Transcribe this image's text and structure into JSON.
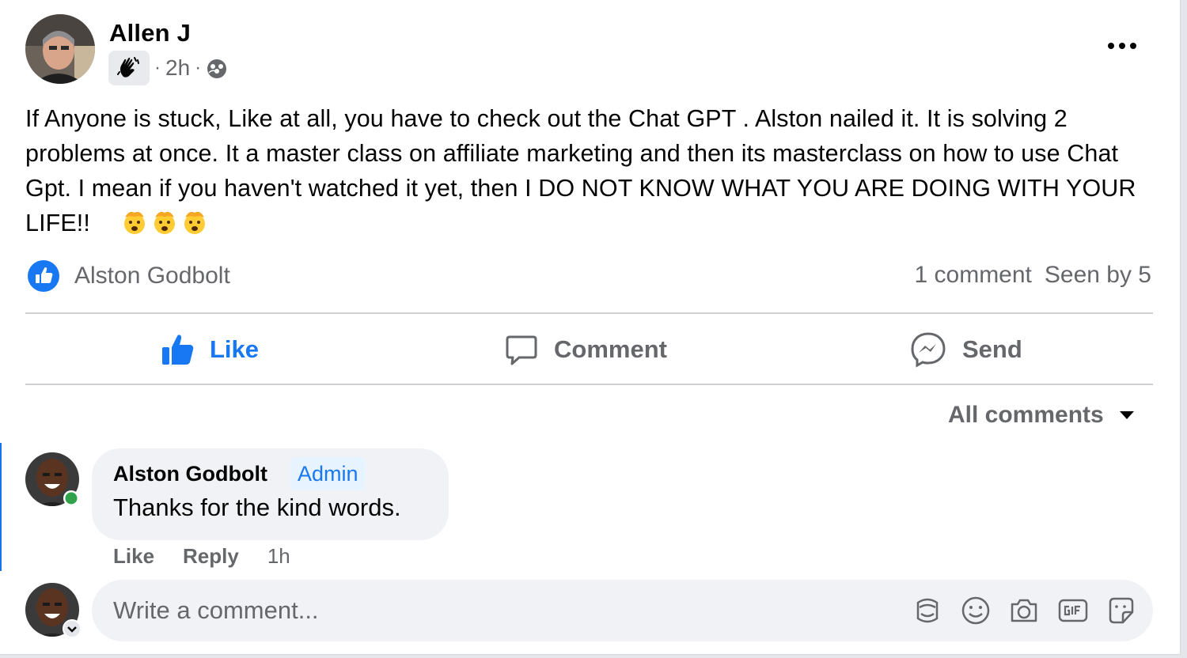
{
  "post": {
    "author": "Allen J",
    "badge_icon": "waving-hand-icon",
    "time": "2h",
    "separator": "·",
    "audience_icon": "group-audience-icon",
    "text": "If Anyone is stuck, Like at all, you have to check out the Chat GPT . Alston nailed it. It is solving 2 problems at once. It a master class on affiliate marketing and then its masterclass on how to use Chat Gpt. I mean if you haven't watched it yet, then I DO NOT KNOW WHAT YOU ARE DOING WITH YOUR LIFE!!",
    "emojis": [
      "exploding-head-emoji",
      "exploding-head-emoji",
      "exploding-head-emoji"
    ]
  },
  "reactions": {
    "reactor": "Alston Godbolt",
    "comment_count": "1 comment",
    "seen_by": "Seen by 5"
  },
  "actions": {
    "like": "Like",
    "comment": "Comment",
    "send": "Send"
  },
  "comments_filter": "All comments",
  "comment": {
    "author": "Alston Godbolt",
    "role_badge": "Admin",
    "text": "Thanks for the kind words.",
    "like": "Like",
    "reply": "Reply",
    "time": "1h"
  },
  "composer": {
    "placeholder": "Write a comment...",
    "icons": [
      "avatar-sticker-icon",
      "emoji-icon",
      "camera-icon",
      "gif-icon",
      "sticker-icon"
    ]
  },
  "colors": {
    "accent": "#1877f2",
    "secondary_text": "#65676b",
    "bubble": "#f0f2f5",
    "online": "#31a24c"
  }
}
